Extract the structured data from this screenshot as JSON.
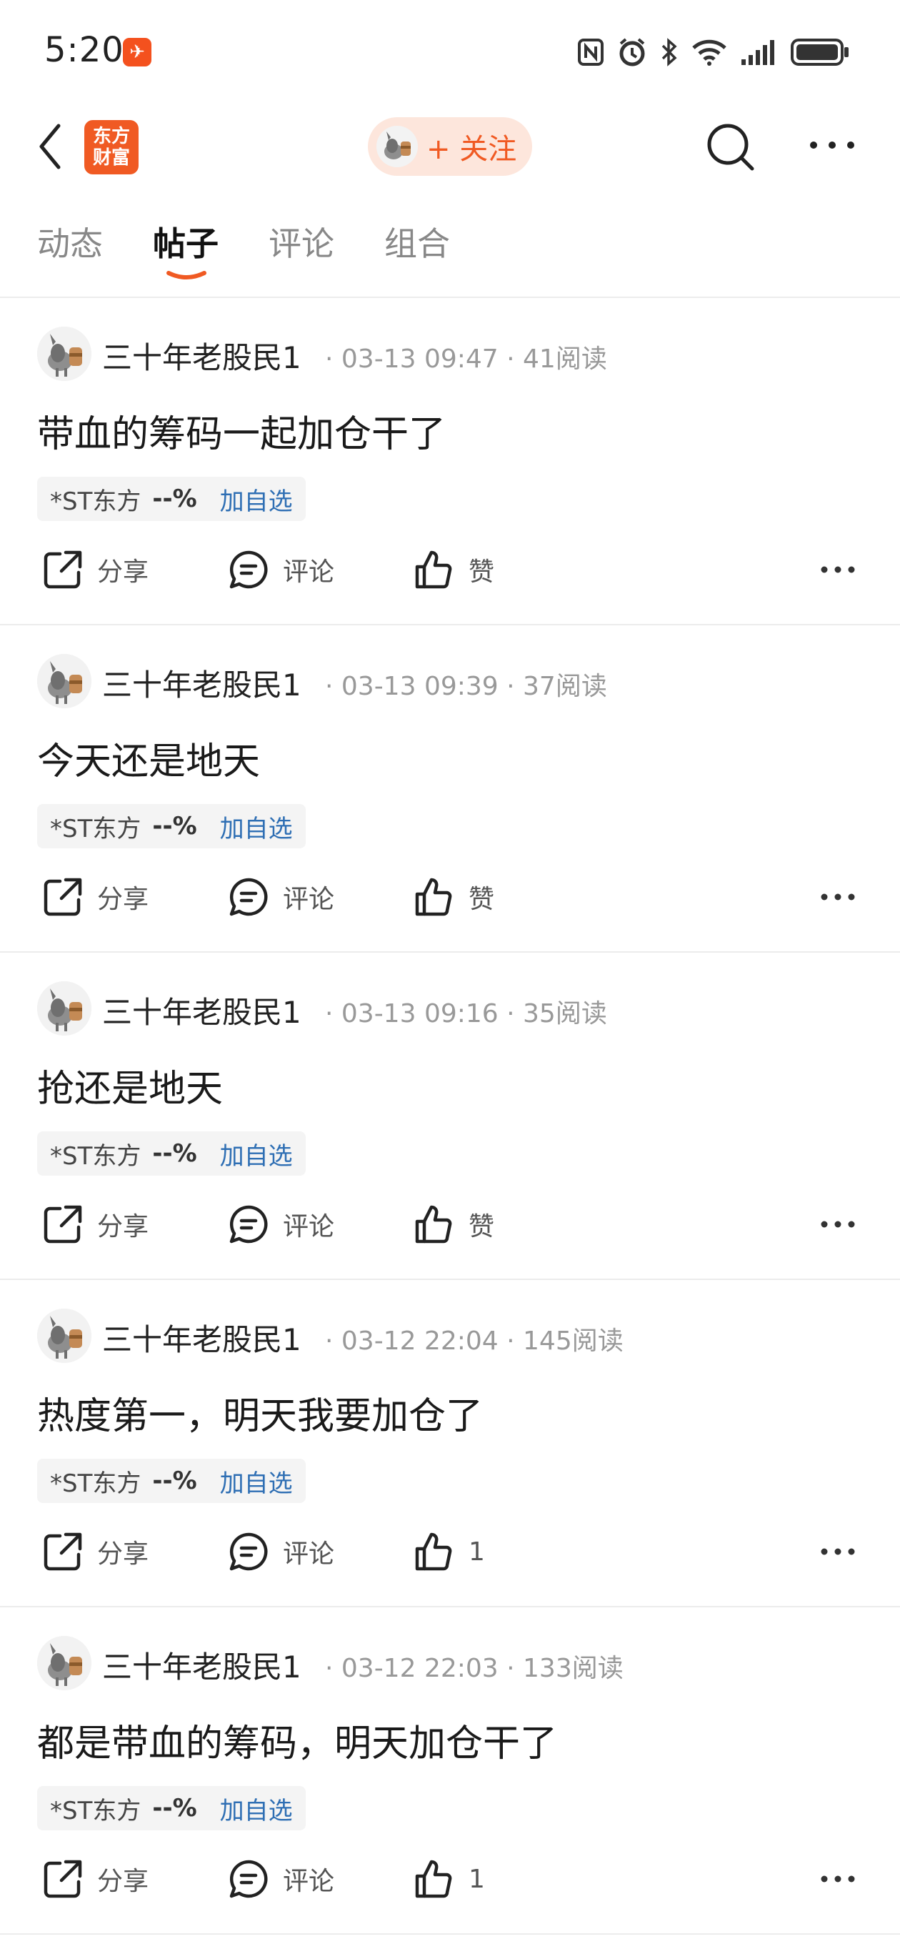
{
  "status": {
    "time": "5:20",
    "notif": "✈"
  },
  "header": {
    "brand_line1": "东方",
    "brand_line2": "财富",
    "follow_label": "+ 关注"
  },
  "tabs": [
    "动态",
    "帖子",
    "评论",
    "组合"
  ],
  "active_tab": 1,
  "posts": [
    {
      "author": "三十年老股民1",
      "meta": "· 03-13 09:47 · 41阅读",
      "title": "带血的筹码一起加仓干了",
      "stock": "*ST东方",
      "pct": "--%",
      "add": "加自选",
      "share": "分享",
      "comment": "评论",
      "like": "赞"
    },
    {
      "author": "三十年老股民1",
      "meta": "· 03-13 09:39 · 37阅读",
      "title": "今天还是地天",
      "stock": "*ST东方",
      "pct": "--%",
      "add": "加自选",
      "share": "分享",
      "comment": "评论",
      "like": "赞"
    },
    {
      "author": "三十年老股民1",
      "meta": "· 03-13 09:16 · 35阅读",
      "title": "抢还是地天",
      "stock": "*ST东方",
      "pct": "--%",
      "add": "加自选",
      "share": "分享",
      "comment": "评论",
      "like": "赞"
    },
    {
      "author": "三十年老股民1",
      "meta": "· 03-12 22:04 · 145阅读",
      "title": "热度第一，明天我要加仓了",
      "stock": "*ST东方",
      "pct": "--%",
      "add": "加自选",
      "share": "分享",
      "comment": "评论",
      "like": "1"
    },
    {
      "author": "三十年老股民1",
      "meta": "· 03-12 22:03 · 133阅读",
      "title": "都是带血的筹码，明天加仓干了",
      "stock": "*ST东方",
      "pct": "--%",
      "add": "加自选",
      "share": "分享",
      "comment": "评论",
      "like": "1"
    }
  ],
  "colors": {
    "accent": "#f05a23",
    "link": "#2f6fb4"
  }
}
